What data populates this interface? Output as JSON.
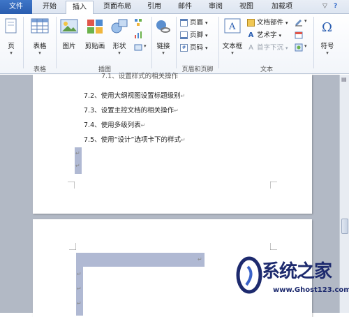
{
  "tabs": [
    "文件",
    "开始",
    "插入",
    "页面布局",
    "引用",
    "邮件",
    "审阅",
    "视图",
    "加载项"
  ],
  "active_tab": "插入",
  "ribbon": {
    "page_btn": "页",
    "table_btn": "表格",
    "picture_btn": "图片",
    "clipart_btn": "剪贴画",
    "shapes_btn": "形状",
    "link_btn": "链接",
    "header_btn": "页眉",
    "footer_btn": "页脚",
    "pagenum_btn": "页码",
    "textbox_btn": "文本框",
    "quickparts_btn": "文档部件",
    "wordart_btn": "艺术字",
    "dropcap_btn": "首字下沉",
    "symbol_btn": "符号",
    "groups": {
      "table": "表格",
      "illustrations": "插图",
      "header_footer": "页眉和页脚",
      "text": "文本"
    }
  },
  "document": {
    "partial_line": "7.1、设置样式的相关操作",
    "lines": [
      "7.2、使用大纲视图设置标题级别",
      "7.3、设置主控文档的相关操作",
      "7.4、使用多级列表",
      "7.5、使用“设计”选项卡下的样式"
    ],
    "para_mark": "↵"
  },
  "watermark": {
    "title": "系统之家",
    "url": "www.Ghost123.com"
  },
  "colors": {
    "file_tab": "#2a5db0",
    "selection": "#b0b9d3",
    "doc_bg": "#b2b9c5"
  }
}
